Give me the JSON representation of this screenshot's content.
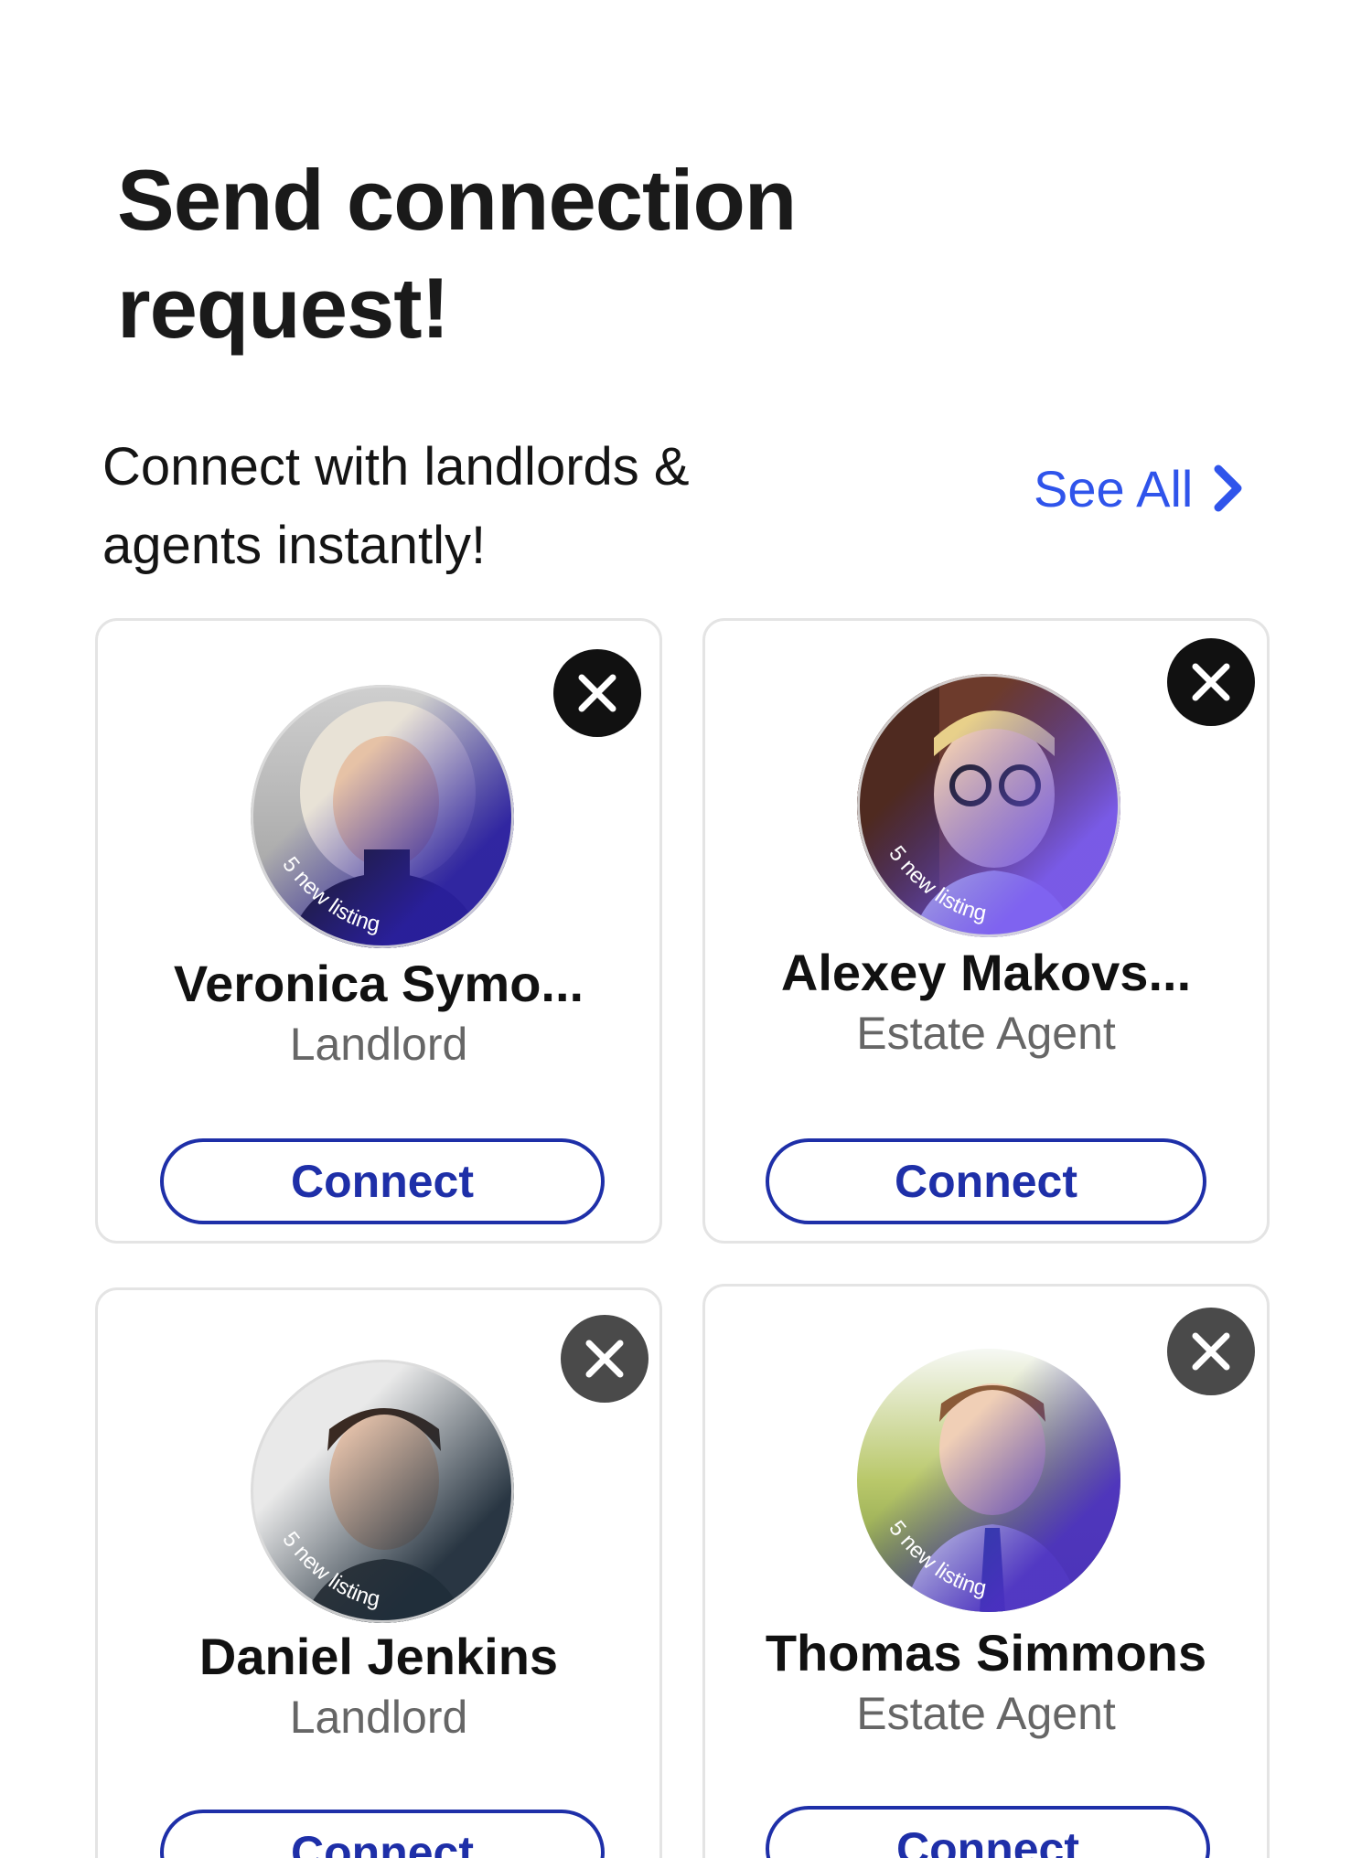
{
  "header": {
    "title": "Send connection request!",
    "subtitle": "Connect with landlords & agents instantly!",
    "see_all_label": "See All"
  },
  "colors": {
    "accent": "#2f54eb",
    "button_border": "#1e2fa8",
    "listing_gradient_start": "#2a1fa0",
    "listing_gradient_end": "#7a5cf0"
  },
  "cards": [
    {
      "name": "Veronica Symo...",
      "role": "Landlord",
      "listing_badge": "5 new listing",
      "connect_label": "Connect",
      "close_icon": "close-icon"
    },
    {
      "name": "Alexey Makovs...",
      "role": "Estate Agent",
      "listing_badge": "5 new listing",
      "connect_label": "Connect",
      "close_icon": "close-icon"
    },
    {
      "name": "Daniel Jenkins",
      "role": "Landlord",
      "listing_badge": "5 new listing",
      "connect_label": "Connect",
      "close_icon": "close-icon"
    },
    {
      "name": "Thomas Simmons",
      "role": "Estate Agent",
      "listing_badge": "5 new listing",
      "connect_label": "Connect",
      "close_icon": "close-icon"
    }
  ]
}
